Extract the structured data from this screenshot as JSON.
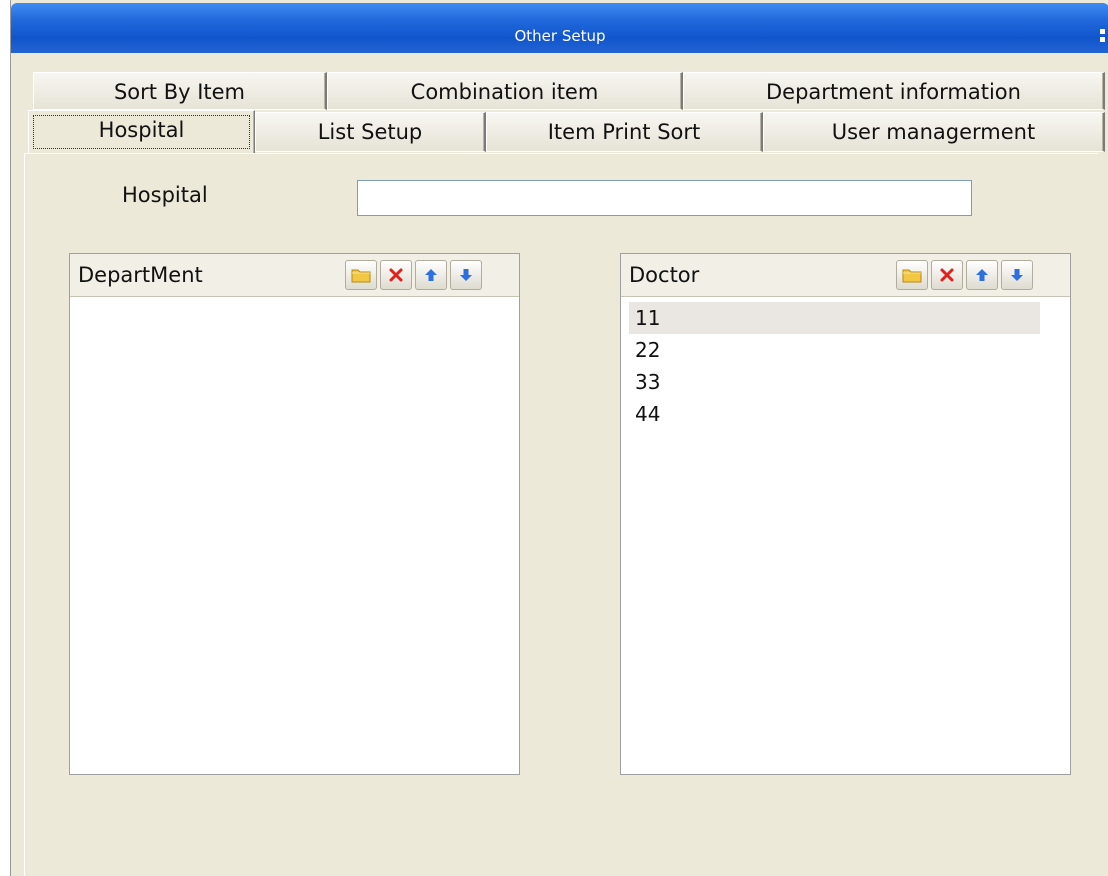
{
  "window": {
    "title": "Other Setup"
  },
  "tabs_row1": [
    {
      "label": "Sort By Item"
    },
    {
      "label": "Combination item"
    },
    {
      "label": "Department information"
    }
  ],
  "tabs_row2": [
    {
      "label": "Hospital"
    },
    {
      "label": "List Setup"
    },
    {
      "label": "Item Print Sort"
    },
    {
      "label": "User managerment"
    }
  ],
  "hospital": {
    "label": "Hospital",
    "value": "",
    "placeholder": ""
  },
  "department_list": {
    "header": "DepartMent",
    "items": []
  },
  "doctor_list": {
    "header": "Doctor",
    "items": [
      "11",
      "22",
      "33",
      "44"
    ],
    "selected_index": 0
  },
  "toolbar_icons": [
    "folder-icon",
    "delete-icon",
    "arrow-up-icon",
    "arrow-down-icon"
  ],
  "colors": {
    "titlebar": "#2068dc",
    "window_bg": "#ece9d8",
    "delete_red": "#e0201a",
    "arrow_blue": "#2b6fe0",
    "folder_yellow": "#f2c744",
    "selection": "#eae6e1"
  }
}
